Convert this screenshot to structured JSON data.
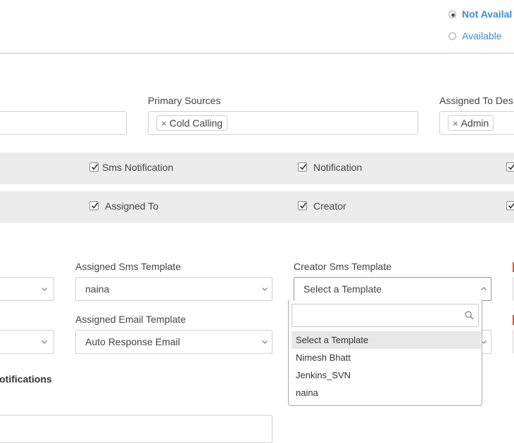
{
  "top_radios": {
    "not_available_label": "Not Availal",
    "available_label": "Available"
  },
  "fields": {
    "primary_sources_label": "Primary Sources",
    "primary_sources_tag": "Cold Calling",
    "assigned_to_label": "Assigned To Des",
    "assigned_to_tag": "Admin",
    "remove_glyph": "×"
  },
  "notify_row1": {
    "sms_notification": "Sms Notification",
    "notification": "Notification"
  },
  "notify_row2": {
    "assigned_to": "Assigned To",
    "creator": "Creator"
  },
  "templates": {
    "assigned_sms_label": "Assigned Sms Template",
    "assigned_sms_value": "naina",
    "creator_sms_label": "Creator Sms Template",
    "creator_sms_value": "Select a Template",
    "assigned_email_label": "Assigned Email Template",
    "assigned_email_value": "Auto Response Email"
  },
  "dropdown": {
    "search_placeholder": "",
    "options": [
      "Select a Template",
      "Nimesh Bhatt",
      "Jenkins_SVN",
      "naina"
    ],
    "highlighted": "Select a Template"
  },
  "section": {
    "notifications_title": "otifications"
  },
  "colors": {
    "link_blue": "#3a8fd6",
    "band_gray": "#ececec",
    "required_red": "#d9534f"
  }
}
